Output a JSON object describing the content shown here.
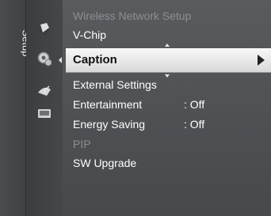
{
  "side_tab": {
    "label": "Setup"
  },
  "icons": [
    "picture-icon",
    "setup-gear-icon",
    "satellite-dish-icon",
    "input-icon"
  ],
  "menu": {
    "items": [
      {
        "label": "Wireless Network Setup",
        "state": "dim"
      },
      {
        "label": "V-Chip",
        "state": "normal"
      },
      {
        "label": "Caption",
        "state": "selected"
      },
      {
        "label": "External Settings",
        "state": "normal"
      },
      {
        "label": "Entertainment",
        "value": ": Off",
        "state": "normal"
      },
      {
        "label": "Energy Saving",
        "value": ": Off",
        "state": "normal"
      },
      {
        "label": "PIP",
        "state": "dim"
      },
      {
        "label": "SW Upgrade",
        "state": "normal"
      }
    ]
  },
  "colors": {
    "selection_bar": "#e9e9e9",
    "menu_bg": "#555659"
  }
}
